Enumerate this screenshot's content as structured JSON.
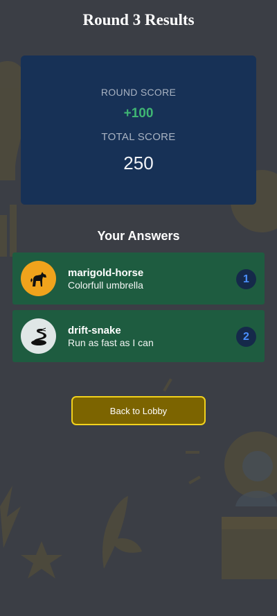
{
  "page": {
    "title": "Round 3 Results"
  },
  "score_card": {
    "round_score_label": "ROUND SCORE",
    "round_score_value": "+100",
    "total_score_label": "TOTAL SCORE",
    "total_score_value": "250"
  },
  "answers": {
    "heading": "Your Answers",
    "items": [
      {
        "player": "marigold-horse",
        "answer": "Colorfull umbrella",
        "rank": "1",
        "avatar_icon": "horse-icon",
        "avatar_color": "#f0a31c"
      },
      {
        "player": "drift-snake",
        "answer": "Run as fast as I can",
        "rank": "2",
        "avatar_icon": "snake-icon",
        "avatar_color": "#dfe6e6"
      }
    ]
  },
  "actions": {
    "back_to_lobby_label": "Back to Lobby"
  },
  "colors": {
    "background": "#3b3e45",
    "score_card": "#173156",
    "round_score": "#3fb673",
    "answer_card": "#1e5c40",
    "button_fill": "#7c6400",
    "button_border": "#f2d21d",
    "rank_text": "#4a90ff"
  }
}
